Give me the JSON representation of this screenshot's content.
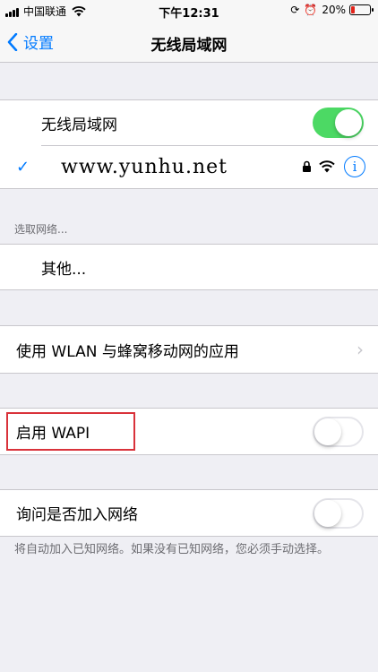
{
  "status_bar": {
    "carrier": "中国联通",
    "time": "下午12:31",
    "battery_percent": "20%",
    "battery_level": 0.2,
    "battery_color": "#e2231a"
  },
  "nav": {
    "back_label": "设置",
    "title": "无线局域网"
  },
  "wifi": {
    "label": "无线局域网",
    "enabled": true,
    "connected_network": "www.yunhu.net"
  },
  "choose_network": {
    "header": "选取网络...",
    "other_label": "其他..."
  },
  "apps": {
    "label": "使用 WLAN 与蜂窝移动网的应用"
  },
  "wapi": {
    "label": "启用 WAPI",
    "enabled": false
  },
  "ask_join": {
    "label": "询问是否加入网络",
    "enabled": false,
    "footer": "将自动加入已知网络。如果没有已知网络，您必须手动选择。"
  },
  "colors": {
    "accent": "#007aff",
    "toggle_on": "#4cd964",
    "highlight": "#d9323a"
  }
}
